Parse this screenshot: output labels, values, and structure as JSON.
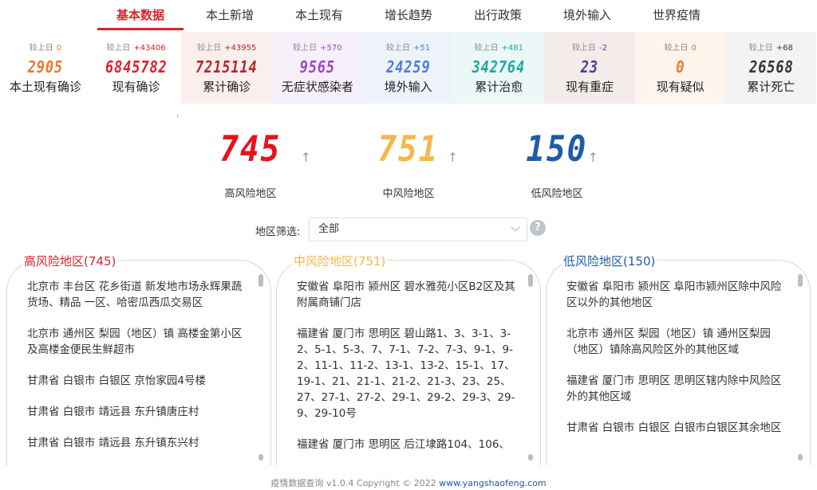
{
  "tabs": [
    {
      "label": "基本数据",
      "active": true
    },
    {
      "label": "本土新增",
      "active": false
    },
    {
      "label": "本土现有",
      "active": false
    },
    {
      "label": "增长趋势",
      "active": false
    },
    {
      "label": "出行政策",
      "active": false
    },
    {
      "label": "境外输入",
      "active": false
    },
    {
      "label": "世界疫情",
      "active": false
    }
  ],
  "stats": [
    {
      "cmp_label": "较上日",
      "delta": "0",
      "value": "2905",
      "label": "本土现有确诊",
      "color": "#e8792c",
      "bg": "#ffffff"
    },
    {
      "cmp_label": "较上日",
      "delta": "+43406",
      "value": "6845782",
      "label": "现有确诊",
      "color": "#d8232a",
      "bg": "#ffffff"
    },
    {
      "cmp_label": "较上日",
      "delta": "+43955",
      "value": "7215114",
      "label": "累计确诊",
      "color": "#b6262a",
      "bg": "#fbefee"
    },
    {
      "cmp_label": "较上日",
      "delta": "+570",
      "value": "9565",
      "label": "无症状感染者",
      "color": "#a044c8",
      "bg": "#f6f0fa"
    },
    {
      "cmp_label": "较上日",
      "delta": "+51",
      "value": "24259",
      "label": "境外输入",
      "color": "#4a7fd6",
      "bg": "#eef3fb"
    },
    {
      "cmp_label": "较上日",
      "delta": "+481",
      "value": "342764",
      "label": "累计治愈",
      "color": "#1ea8a0",
      "bg": "#ecf7f7"
    },
    {
      "cmp_label": "较上日",
      "delta": "-2",
      "value": "23",
      "label": "现有重症",
      "color": "#4b3f8e",
      "bg": "#f4ebeb"
    },
    {
      "cmp_label": "较上日",
      "delta": "0",
      "value": "0",
      "label": "现有疑似",
      "color": "#e8792c",
      "bg": "#fdf4ec"
    },
    {
      "cmp_label": "较上日",
      "delta": "+68",
      "value": "26568",
      "label": "累计死亡",
      "color": "#333333",
      "bg": "#f3f3f3"
    }
  ],
  "risk": [
    {
      "value": "745",
      "label": "高风险地区",
      "color": "#e8121d"
    },
    {
      "value": "751",
      "label": "中风险地区",
      "color": "#f5b74b"
    },
    {
      "value": "150",
      "label": "低风险地区",
      "color": "#1f5ca8"
    }
  ],
  "filter": {
    "label": "地区筛选:",
    "value": "全部",
    "help": "?"
  },
  "panels": [
    {
      "title": "高风险地区(745)",
      "color": "#d8232a",
      "items": [
        "北京市 丰台区 花乡街道 新发地市场永辉果蔬货场、精品 一区、哈密瓜西瓜交易区",
        "北京市 通州区 梨园（地区）镇 高楼金第小区及高楼金便民生鲜超市",
        "甘肃省 白银市 白银区 京怡家园4号楼",
        "甘肃省 白银市 靖远县 东升镇唐庄村",
        "甘肃省 白银市 靖远县 东升镇东兴村"
      ]
    },
    {
      "title": "中风险地区(751)",
      "color": "#f5b74b",
      "items": [
        "安徽省 阜阳市 颍州区 碧水雅苑小区B2区及其附属商铺门店",
        "福建省 厦门市 思明区 碧山路1、3、3-1、3-2、5-1、5-3、7、7-1、7-2、7-3、9-1、9-2、11-1、11-2、13-1、13-2、15-1、17、19-1、21、21-1、21-2、21-3、23、25、27、27-1、27-2、29-1、29-2、29-3、29-9、29-10号",
        "福建省 厦门市 思明区 后江埭路104、106、"
      ]
    },
    {
      "title": "低风险地区(150)",
      "color": "#1f5ca8",
      "items": [
        "安徽省 阜阳市 颍州区 阜阳市颍州区除中风险区以外的其他地区",
        "北京市 通州区 梨园（地区）镇 通州区梨园（地区）镇除高风险区外的其他区域",
        "福建省 厦门市 思明区 思明区辖内除中风险区外的其他区域",
        "甘肃省 白银市 白银区 白银市白银区其余地区"
      ]
    }
  ],
  "footer": {
    "text": "疫情数据查询 v1.0.4 Copyright © 2022",
    "link": "www.yangshaofeng.com"
  },
  "misc": {
    "cursor_mark": "ᵢ"
  },
  "icons": {
    "risk_arrow": "arrow-up-icon",
    "select_chevron": "chevron-down-icon"
  }
}
